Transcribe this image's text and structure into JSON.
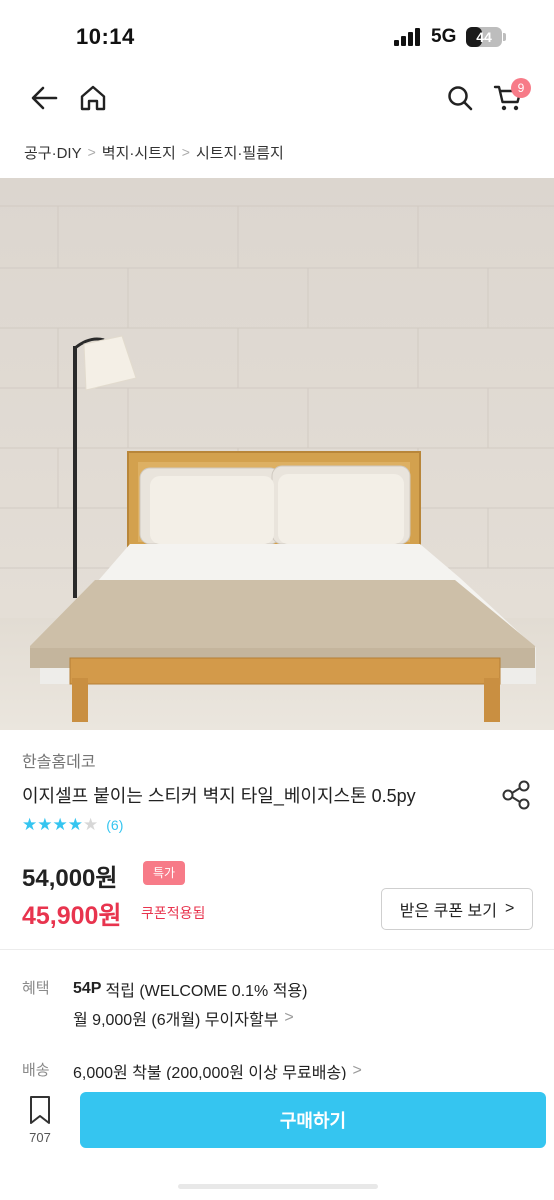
{
  "status_bar": {
    "time": "10:14",
    "network": "5G",
    "battery": "44",
    "battery_level": 0.44
  },
  "header": {
    "back_icon": "arrow-left-icon",
    "home_icon": "home-icon",
    "search_icon": "search-icon",
    "cart_icon": "cart-icon",
    "cart_badge": "9"
  },
  "breadcrumb": [
    "공구·DIY",
    "벽지·시트지",
    "시트지·필름지"
  ],
  "product": {
    "brand": "한솔홈데코",
    "title": "이지셀프 붙이는 스티커 벽지 타일_베이지스톤 0.5py",
    "rating": 4,
    "review_count": "(6)",
    "price_original": "54,000원",
    "price_badge": "특가",
    "price_sale": "45,900원",
    "coupon_note": "쿠폰적용됨",
    "coupon_button": "받은 쿠폰 보기"
  },
  "benefits": {
    "label": "혜택",
    "points": "54P",
    "points_text": "적립 (WELCOME 0.1% 적용)",
    "installment": "월 9,000원 (6개월) 무이자할부"
  },
  "shipping": {
    "label": "배송",
    "text": "6,000원 착불 (200,000원 이상 무료배송)"
  },
  "bottom": {
    "bookmark_count": "707",
    "buy_label": "구매하기"
  },
  "colors": {
    "accent": "#35c5f0",
    "sale": "#e8344e",
    "badge": "#f77b88"
  }
}
